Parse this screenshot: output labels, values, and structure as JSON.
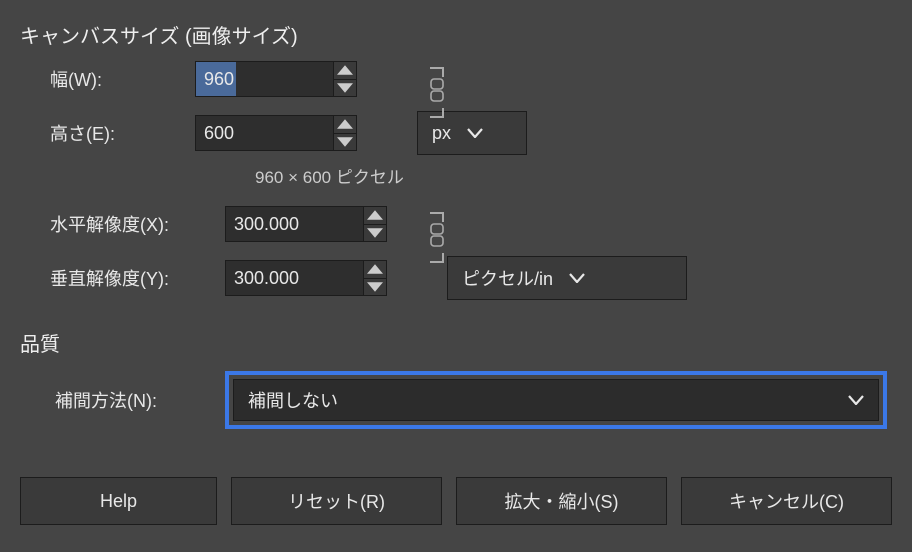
{
  "canvas_section": {
    "title": "キャンバスサイズ (画像サイズ)",
    "width_label": "幅(W):",
    "width_value": "960",
    "height_label": "高さ(E):",
    "height_value": "600",
    "size_unit": "px",
    "hint": "960 × 600 ピクセル",
    "xres_label": "水平解像度(X):",
    "xres_value": "300.000",
    "yres_label": "垂直解像度(Y):",
    "yres_value": "300.000",
    "res_unit": "ピクセル/in"
  },
  "quality_section": {
    "title": "品質",
    "interp_label": "補間方法(N):",
    "interp_value": "補間しない"
  },
  "buttons": {
    "help": "Help",
    "reset": "リセット(R)",
    "scale": "拡大・縮小(S)",
    "cancel": "キャンセル(C)"
  }
}
